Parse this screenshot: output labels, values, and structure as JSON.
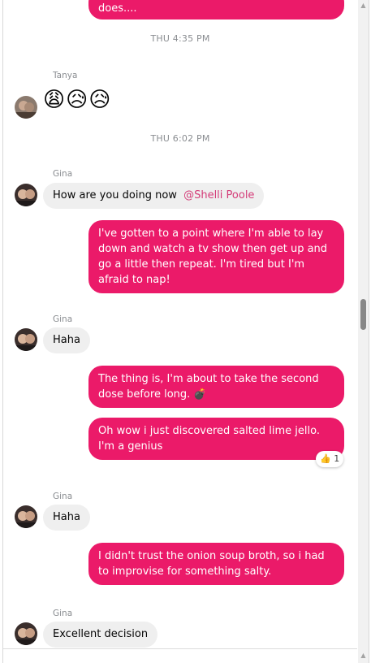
{
  "colors": {
    "outgoing_bubble": "#eb1a69",
    "incoming_bubble": "#efefef",
    "mention": "#d43c78"
  },
  "top_partial": {
    "text": "does...."
  },
  "timestamps": [
    "THU 4:35 PM",
    "THU 6:02 PM"
  ],
  "messages": {
    "tanya_emojis": {
      "sender": "Tanya",
      "text": "😩😥😥"
    },
    "gina_1": {
      "sender": "Gina",
      "text": "How are you doing now",
      "mention": "@Shelli Poole"
    },
    "out_1": {
      "text": "I've gotten to a point where I'm able to lay down and watch a tv show then get up and go a little then repeat. I'm tired but I'm afraid to nap!"
    },
    "gina_2": {
      "sender": "Gina",
      "text": "Haha"
    },
    "out_2": {
      "text": "The thing is, I'm about to take the second dose before long. 💣"
    },
    "out_3": {
      "text": "Oh wow i just discovered salted lime jello. I'm a genius",
      "reaction_icon": "thumbs-up-icon",
      "reaction": "👍",
      "reaction_count": "1"
    },
    "gina_3": {
      "sender": "Gina",
      "text": "Haha"
    },
    "out_4": {
      "text": "I didn't trust the onion soup broth, so i had to improvise for something salty."
    },
    "gina_4": {
      "sender": "Gina",
      "text": "Excellent decision"
    }
  }
}
